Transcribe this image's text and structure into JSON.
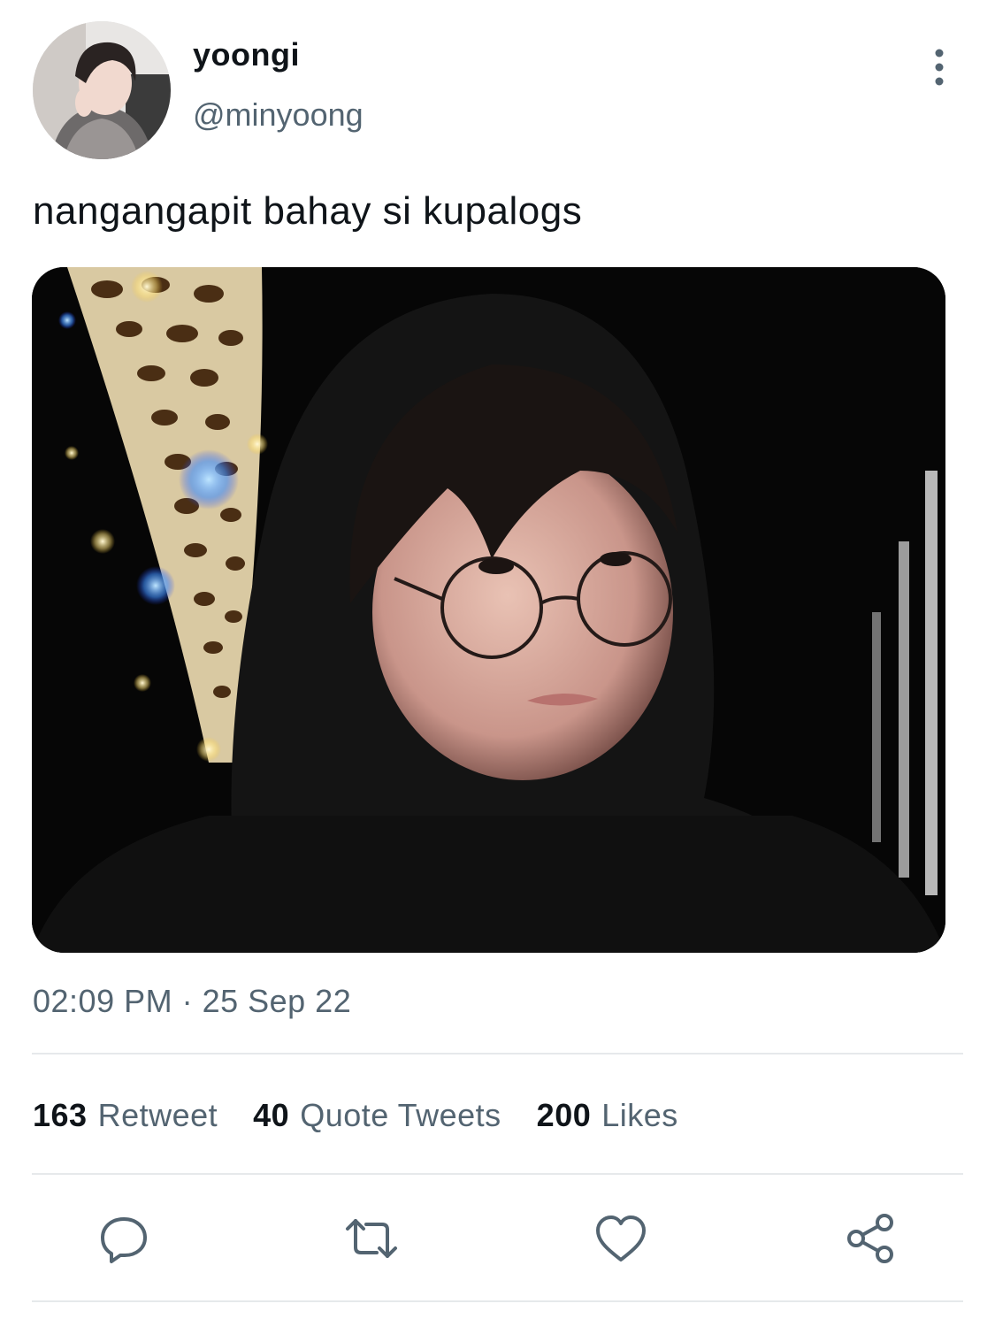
{
  "user": {
    "display_name": "yoongi",
    "handle": "@minyoong",
    "avatar_icon": "profile-photo"
  },
  "tweet": {
    "text": "nangangapit bahay si kupalogs",
    "media_icon": "attached-photo",
    "timestamp": "02:09 PM · 25 Sep 22"
  },
  "stats": [
    {
      "count": "163",
      "label": "Retweet"
    },
    {
      "count": "40",
      "label": "Quote Tweets"
    },
    {
      "count": "200",
      "label": "Likes"
    }
  ],
  "actions": [
    {
      "icon": "reply-icon"
    },
    {
      "icon": "retweet-icon"
    },
    {
      "icon": "like-icon"
    },
    {
      "icon": "share-icon"
    }
  ],
  "menu_icon": "more-vertical-icon",
  "colors": {
    "primary_text": "#0f1419",
    "secondary_text": "#536471",
    "divider": "#e6e9eb",
    "icon": "#536471"
  }
}
